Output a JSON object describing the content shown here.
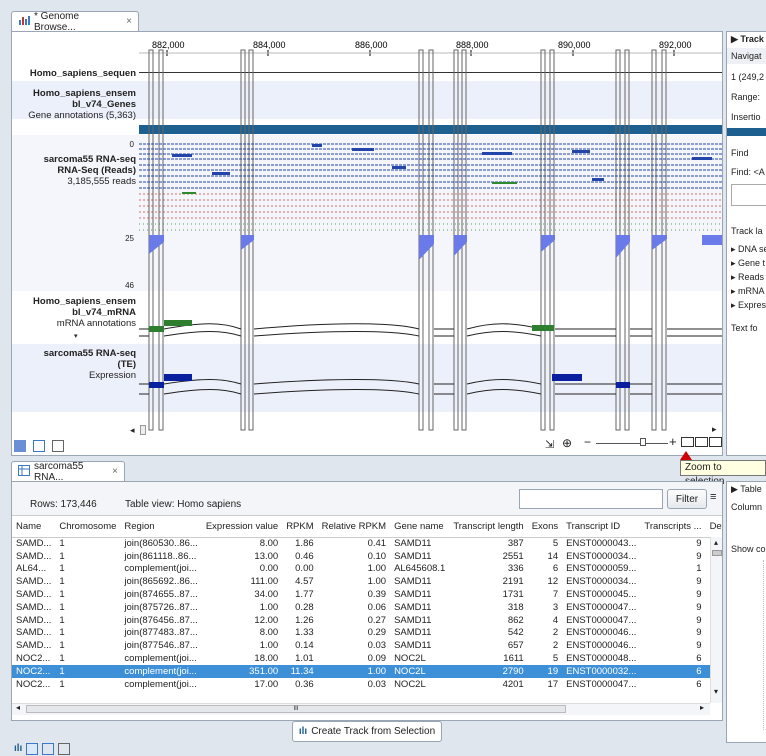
{
  "browser_tab": {
    "title": "* Genome Browse...",
    "close": "×"
  },
  "ruler": {
    "ticks": [
      "882,000",
      "884,000",
      "886,000",
      "888,000",
      "890,000",
      "892,000"
    ]
  },
  "tracks": {
    "sequence": {
      "name": "Homo_sapiens_sequen"
    },
    "genes": {
      "name1": "Homo_sapiens_ensem",
      "name2": "bl_v74_Genes",
      "sub": "Gene annotations (5,363)"
    },
    "reads": {
      "name1": "sarcoma55 RNA-seq",
      "name2": "RNA-Seq (Reads)",
      "sub": "3,185,555 reads",
      "tick0": "0",
      "tick25": "25",
      "tick46": "46"
    },
    "mrna": {
      "name1": "Homo_sapiens_ensem",
      "name2": "bl_v74_mRNA",
      "sub": "mRNA annotations"
    },
    "te": {
      "name1": "sarcoma55 RNA-seq",
      "name2": "(TE)",
      "sub": "Expression"
    }
  },
  "side_panel": {
    "header": "Track",
    "navigation": "Navigat",
    "position": "1 (249,2",
    "range": "Range:",
    "insertions": "Insertio",
    "find_label": "Find",
    "find_field": "Find:",
    "find_value": "<A",
    "track_layout": "Track la",
    "items": [
      "DNA se",
      "Gene t",
      "Reads",
      "mRNA",
      "Expres"
    ],
    "text_format": "Text fo"
  },
  "tooltip": {
    "text": "Zoom to selection"
  },
  "table_tab": {
    "title": "sarcoma55 RNA...",
    "close": "×"
  },
  "table_toolbar": {
    "rows": "Rows: 173,446",
    "view": "Table view: Homo sapiens",
    "filter_button": "Filter",
    "filter_value": ""
  },
  "table": {
    "columns": [
      "Name",
      "Chromosome",
      "Region",
      "Expression value",
      "RPKM",
      "Relative RPKM",
      "Gene name",
      "Transcript length",
      "Exons",
      "Transcript ID",
      "Transcripts ...",
      "Detec"
    ],
    "rows": [
      [
        "SAMD...",
        "1",
        "join(860530..86...",
        "8.00",
        "1.86",
        "0.41",
        "SAMD11",
        "387",
        "5",
        "ENST0000043...",
        "9"
      ],
      [
        "SAMD...",
        "1",
        "join(861118..86...",
        "13.00",
        "0.46",
        "0.10",
        "SAMD11",
        "2551",
        "14",
        "ENST0000034...",
        "9"
      ],
      [
        "AL64...",
        "1",
        "complement(joi...",
        "0.00",
        "0.00",
        "1.00",
        "AL645608.1",
        "336",
        "6",
        "ENST0000059...",
        "1"
      ],
      [
        "SAMD...",
        "1",
        "join(865692..86...",
        "111.00",
        "4.57",
        "1.00",
        "SAMD11",
        "2191",
        "12",
        "ENST0000034...",
        "9"
      ],
      [
        "SAMD...",
        "1",
        "join(874655..87...",
        "34.00",
        "1.77",
        "0.39",
        "SAMD11",
        "1731",
        "7",
        "ENST0000045...",
        "9"
      ],
      [
        "SAMD...",
        "1",
        "join(875726..87...",
        "1.00",
        "0.28",
        "0.06",
        "SAMD11",
        "318",
        "3",
        "ENST0000047...",
        "9"
      ],
      [
        "SAMD...",
        "1",
        "join(876456..87...",
        "12.00",
        "1.26",
        "0.27",
        "SAMD11",
        "862",
        "4",
        "ENST0000047...",
        "9"
      ],
      [
        "SAMD...",
        "1",
        "join(877483..87...",
        "8.00",
        "1.33",
        "0.29",
        "SAMD11",
        "542",
        "2",
        "ENST0000046...",
        "9"
      ],
      [
        "SAMD...",
        "1",
        "join(877546..87...",
        "1.00",
        "0.14",
        "0.03",
        "SAMD11",
        "657",
        "2",
        "ENST0000046...",
        "9"
      ],
      [
        "NOC2...",
        "1",
        "complement(joi...",
        "18.00",
        "1.01",
        "0.09",
        "NOC2L",
        "1611",
        "5",
        "ENST0000048...",
        "6"
      ],
      [
        "NOC2...",
        "1",
        "complement(joi...",
        "351.00",
        "11.34",
        "1.00",
        "NOC2L",
        "2790",
        "19",
        "ENST0000032...",
        "6"
      ],
      [
        "NOC2...",
        "1",
        "complement(joi...",
        "17.00",
        "0.36",
        "0.03",
        "NOC2L",
        "4201",
        "17",
        "ENST0000047...",
        "6"
      ]
    ],
    "selected_row": 10
  },
  "table_side": {
    "header": "Table",
    "column": "Column",
    "show": "Show co"
  },
  "create_track_button": "Create Track from Selection",
  "scroll_label": "III"
}
